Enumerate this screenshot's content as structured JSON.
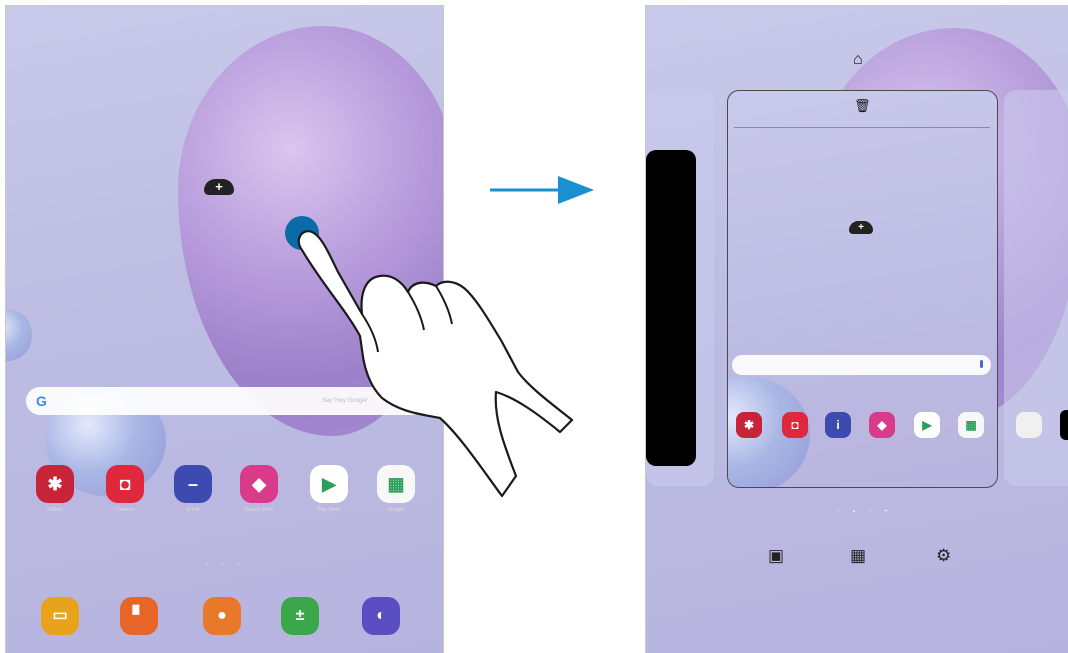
{
  "left_screen": {
    "cloud_add": "+",
    "search": {
      "logo": "G",
      "placeholder": "Say 'Hey Google'"
    },
    "apps": [
      {
        "icon": "flower-icon",
        "glyph": "✱",
        "label": "Gallery",
        "color": "#c7243a"
      },
      {
        "icon": "camera-icon",
        "glyph": "◘",
        "label": "Camera",
        "color": "#e0283d"
      },
      {
        "icon": "minus-circle-icon",
        "glyph": "–",
        "label": "Email",
        "color": "#3d4ab0"
      },
      {
        "icon": "shopping-bag-icon",
        "glyph": "◆",
        "label": "Galaxy Store",
        "color": "#d93a8a"
      },
      {
        "icon": "play-store-icon",
        "glyph": "▶",
        "label": "Play Store",
        "color": "#ffffff"
      },
      {
        "icon": "google-folder-icon",
        "glyph": "▦",
        "label": "Google",
        "color": "#f7f7f7"
      }
    ],
    "page_dots": "◦ ◦ ◦",
    "dock": [
      {
        "icon": "folder-icon",
        "glyph": "▭",
        "color": "#e8a21c"
      },
      {
        "icon": "notes-icon",
        "glyph": "▘",
        "color": "#e8652a"
      },
      {
        "icon": "contacts-icon",
        "glyph": "●",
        "color": "#e8782a"
      },
      {
        "icon": "calculator-icon",
        "glyph": "±",
        "color": "#3aa84a"
      },
      {
        "icon": "internet-icon",
        "glyph": "◐",
        "color": "#5a4ec2"
      }
    ]
  },
  "right_screen": {
    "home_glyph": "⌂",
    "delete_glyph": "🗑",
    "cloud_add": "+",
    "mini_apps": [
      {
        "icon": "flower-icon",
        "glyph": "✱",
        "color": "#c7243a"
      },
      {
        "icon": "camera-icon",
        "glyph": "◘",
        "color": "#e0283d"
      },
      {
        "icon": "info-icon",
        "glyph": "i",
        "color": "#3d4ab0"
      },
      {
        "icon": "shopping-bag-icon",
        "glyph": "◆",
        "color": "#d93a8a"
      },
      {
        "icon": "play-store-icon",
        "glyph": "▶",
        "color": "#ffffff"
      },
      {
        "icon": "google-folder-icon",
        "glyph": "▦",
        "color": "#f7f7f7"
      }
    ],
    "bottom_options": [
      {
        "icon": "wallpapers-icon",
        "glyph": "▣"
      },
      {
        "icon": "widgets-icon",
        "glyph": "▦"
      },
      {
        "icon": "settings-icon",
        "glyph": "⚙"
      }
    ]
  }
}
